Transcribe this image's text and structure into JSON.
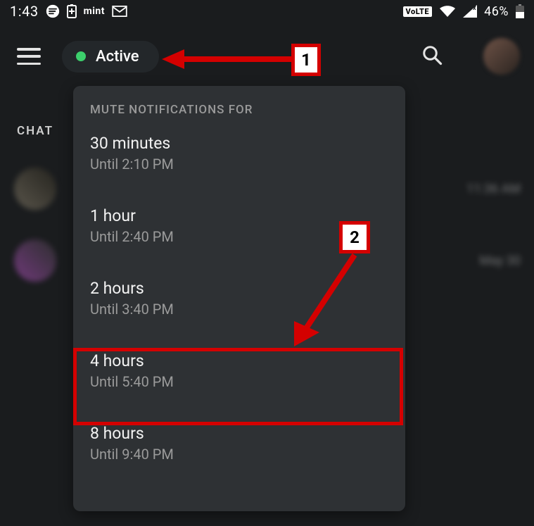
{
  "status": {
    "time": "1:43",
    "volte": "VoLTE",
    "battery_pct": "46%",
    "carrier": "mint"
  },
  "header": {
    "chip_label": "Active"
  },
  "sidebar": {
    "chat_label": "CHAT"
  },
  "bg_rows": [
    {
      "ts": "11:36 AM"
    },
    {
      "ts": "May 30"
    }
  ],
  "popup": {
    "title": "MUTE NOTIFICATIONS FOR",
    "options": [
      {
        "label": "30 minutes",
        "until": "Until 2:10 PM"
      },
      {
        "label": "1 hour",
        "until": "Until 2:40 PM"
      },
      {
        "label": "2 hours",
        "until": "Until 3:40 PM"
      },
      {
        "label": "4 hours",
        "until": "Until 5:40 PM"
      },
      {
        "label": "8 hours",
        "until": "Until 9:40 PM"
      }
    ]
  },
  "callouts": {
    "one": "1",
    "two": "2"
  }
}
